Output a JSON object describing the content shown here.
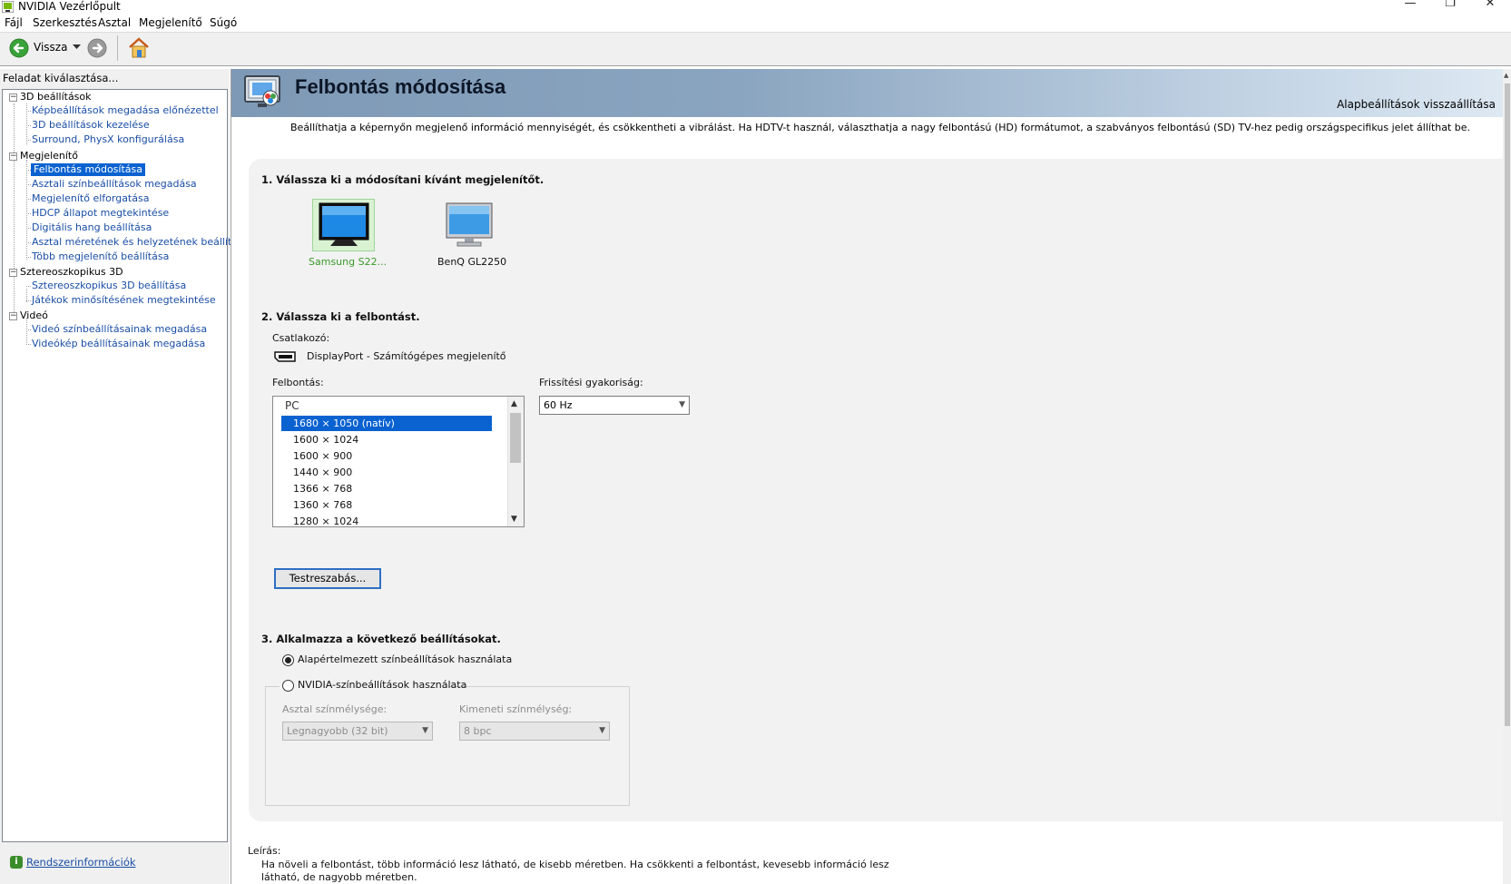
{
  "window": {
    "title": "NVIDIA Vezérlőpult",
    "controls": {
      "minimize": "—",
      "restore": "❐",
      "close": "✕"
    }
  },
  "menu": [
    "Fájl",
    "Szerkesztés",
    "Asztal",
    "Megjelenítő",
    "Súgó"
  ],
  "toolbar": {
    "back_label": "Vissza"
  },
  "left_panel": {
    "label": "Feladat kiválasztása...",
    "tree": [
      {
        "label": "3D beállítások",
        "items": [
          "Képbeállítások megadása előnézettel",
          "3D beállítások kezelése",
          "Surround, PhysX konfigurálása"
        ]
      },
      {
        "label": "Megjelenítő",
        "items": [
          "Felbontás módosítása",
          "Asztali színbeállítások megadása",
          "Megjelenítő elforgatása",
          "HDCP állapot megtekintése",
          "Digitális hang beállítása",
          "Asztal méretének és helyzetének beállítása",
          "Több megjelenítő beállítása"
        ]
      },
      {
        "label": "Sztereoszkopikus 3D",
        "items": [
          "Sztereoszkopikus 3D beállítása",
          "Játékok minősítésének megtekintése"
        ]
      },
      {
        "label": "Videó",
        "items": [
          "Videó színbeállításainak megadása",
          "Videókép beállításainak megadása"
        ]
      }
    ],
    "selected": "Felbontás módosítása",
    "system_info": "Rendszerinformációk"
  },
  "page": {
    "title": "Felbontás módosítása",
    "reset_link": "Alapbeállítások visszaállítása",
    "intro": "Beállíthatja a képernyőn megjelenő információ mennyiségét, és csökkentheti a vibrálást. Ha HDTV-t használ, választhatja a nagy felbontású (HD) formátumot, a szabványos felbontású (SD) TV-hez pedig országspecifikus jelet állíthat be.",
    "step1": {
      "heading": "1. Válassza ki a módosítani kívánt megjelenítőt.",
      "displays": [
        {
          "name": "Samsung S22...",
          "selected": true
        },
        {
          "name": "BenQ GL2250",
          "selected": false
        }
      ]
    },
    "step2": {
      "heading": "2. Válassza ki a felbontást.",
      "connector_label": "Csatlakozó:",
      "connector_value": "DisplayPort - Számítógépes megjelenítő",
      "resolution_label": "Felbontás:",
      "group": "PC",
      "resolutions": [
        "1680 × 1050 (natív)",
        "1600 × 1024",
        "1600 × 900",
        "1440 × 900",
        "1366 × 768",
        "1360 × 768",
        "1280 × 1024"
      ],
      "selected_resolution": "1680 × 1050 (natív)",
      "refresh_label": "Frissítési gyakoriság:",
      "refresh_value": "60 Hz",
      "customize_button": "Testreszabás..."
    },
    "step3": {
      "heading": "3. Alkalmazza a következő beállításokat.",
      "option_default": "Alapértelmezett színbeállítások használata",
      "option_nvidia": "NVIDIA-színbeállítások használata",
      "selected_option": "default",
      "desktop_depth_label": "Asztal színmélysége:",
      "desktop_depth_value": "Legnagyobb (32 bit)",
      "output_depth_label": "Kimeneti színmélység:",
      "output_depth_value": "8 bpc"
    },
    "description": {
      "label": "Leírás:",
      "text": "Ha növeli a felbontást, több információ lesz látható, de kisebb méretben. Ha csökkenti a felbontást, kevesebb információ lesz látható, de nagyobb méretben."
    }
  },
  "colors": {
    "accent_selection": "#0a62d0",
    "link_blue": "#1a4ea5",
    "selected_display_text": "#3a9a2a",
    "header_band": "#8aa5c0"
  }
}
